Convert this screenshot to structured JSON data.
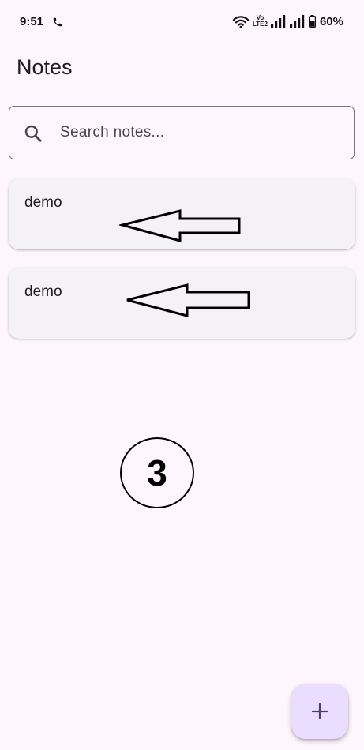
{
  "status_bar": {
    "time": "9:51",
    "volte_top": "Vo",
    "volte_bottom": "LTE2",
    "battery": "60%",
    "icons": [
      "phone-icon",
      "wifi-icon",
      "signal-icon",
      "signal-icon",
      "battery-icon"
    ]
  },
  "app": {
    "title": "Notes"
  },
  "search": {
    "placeholder": "Search notes...",
    "value": "",
    "icon": "search-icon"
  },
  "notes": [
    {
      "title": "demo"
    },
    {
      "title": "demo"
    }
  ],
  "annotation": {
    "step_number": "3"
  },
  "fab": {
    "icon": "plus-icon",
    "accent": "#eaddff"
  }
}
